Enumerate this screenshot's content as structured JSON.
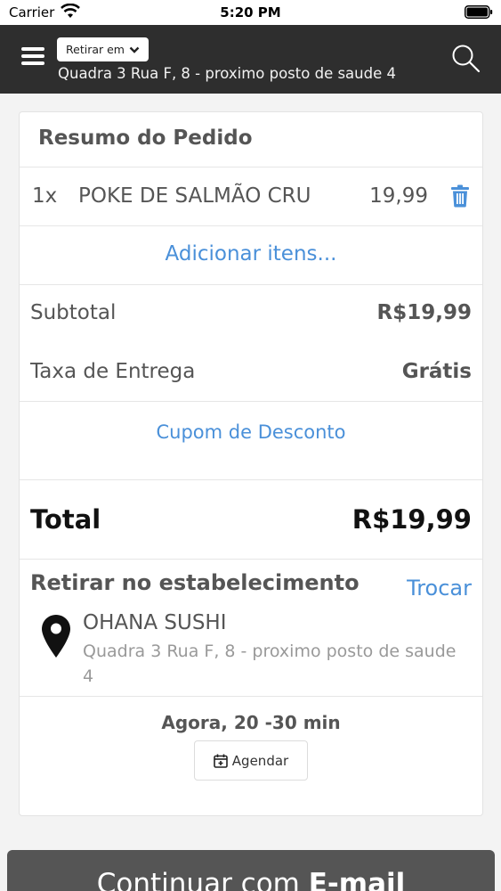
{
  "status_bar": {
    "carrier": "Carrier",
    "time": "5:20 PM"
  },
  "header": {
    "mode_label": "Retirar em",
    "address": "Quadra 3 Rua F, 8 - proximo posto de saude 4",
    "background": "#2e2e2e"
  },
  "order": {
    "title": "Resumo do Pedido",
    "items": [
      {
        "qty": "1x",
        "name": "POKE DE SALMÃO CRU",
        "price": "19,99"
      }
    ],
    "add_items_label": "Adicionar itens...",
    "subtotal_label": "Subtotal",
    "subtotal_value": "R$19,99",
    "delivery_label": "Taxa de Entrega",
    "delivery_value": "Grátis",
    "coupon_label": "Cupom de Desconto",
    "total_label": "Total",
    "total_value": "R$19,99"
  },
  "pickup": {
    "title": "Retirar no estabelecimento",
    "change_label": "Trocar",
    "store_name": "OHANA SUSHI",
    "store_address": "Quadra 3 Rua F, 8 - proximo posto de saude 4",
    "time_label": "Agora, 20 -30 min",
    "schedule_label": "Agendar"
  },
  "footer": {
    "continue_prefix": "Continuar com ",
    "continue_method": "E-mail"
  },
  "colors": {
    "accent": "#4a90d9",
    "text": "#555555",
    "button": "#555555"
  },
  "icons": [
    "wifi-icon",
    "battery-icon",
    "menu-icon",
    "chevron-down-icon",
    "search-icon",
    "trash-icon",
    "map-pin-icon",
    "calendar-plus-icon"
  ]
}
